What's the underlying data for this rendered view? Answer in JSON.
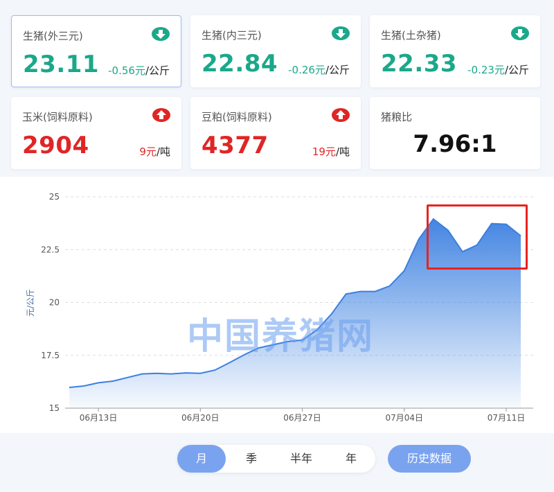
{
  "cards": [
    {
      "title": "生猪(外三元)",
      "value": "23.11",
      "change": "-0.56元",
      "unit": "/公斤",
      "trend": "down"
    },
    {
      "title": "生猪(内三元)",
      "value": "22.84",
      "change": "-0.26元",
      "unit": "/公斤",
      "trend": "down"
    },
    {
      "title": "生猪(土杂猪)",
      "value": "22.33",
      "change": "-0.23元",
      "unit": "/公斤",
      "trend": "down"
    },
    {
      "title": "玉米(饲料原料)",
      "value": "2904",
      "change": "9元",
      "unit": "/吨",
      "trend": "up"
    },
    {
      "title": "豆粕(饲料原料)",
      "value": "4377",
      "change": "19元",
      "unit": "/吨",
      "trend": "up"
    },
    {
      "title": "猪粮比",
      "value": "7.96:1"
    }
  ],
  "colors": {
    "down": "#1aa88a",
    "up": "#e02525",
    "accent": "#7aa3ef",
    "line": "#3a7fe0"
  },
  "chart_data": {
    "type": "area",
    "ylabel": "元/公斤",
    "ylim": [
      15,
      25
    ],
    "yticks": [
      15,
      17.5,
      20,
      22.5,
      25
    ],
    "xticks": [
      "06月13日",
      "06月20日",
      "06月27日",
      "07月04日",
      "07月11日"
    ],
    "x": [
      "06-11",
      "06-12",
      "06-13",
      "06-14",
      "06-15",
      "06-16",
      "06-17",
      "06-18",
      "06-19",
      "06-20",
      "06-21",
      "06-22",
      "06-23",
      "06-24",
      "06-25",
      "06-26",
      "06-27",
      "06-28",
      "06-29",
      "06-30",
      "07-01",
      "07-02",
      "07-03",
      "07-04",
      "07-05",
      "07-06",
      "07-07",
      "07-08",
      "07-09",
      "07-10",
      "07-11",
      "07-12"
    ],
    "values": [
      15.98,
      16.05,
      16.2,
      16.28,
      16.45,
      16.62,
      16.65,
      16.62,
      16.67,
      16.65,
      16.8,
      17.15,
      17.52,
      17.85,
      18.0,
      18.15,
      18.22,
      18.7,
      19.45,
      20.4,
      20.52,
      20.52,
      20.78,
      21.5,
      23.0,
      23.95,
      23.42,
      22.4,
      22.72,
      23.73,
      23.7,
      23.15
    ],
    "grid": "horizontal dashed"
  },
  "watermark": "中国养猪网",
  "tabs": [
    {
      "label": "月",
      "active": true
    },
    {
      "label": "季"
    },
    {
      "label": "半年"
    },
    {
      "label": "年"
    }
  ],
  "history_label": "历史数据"
}
